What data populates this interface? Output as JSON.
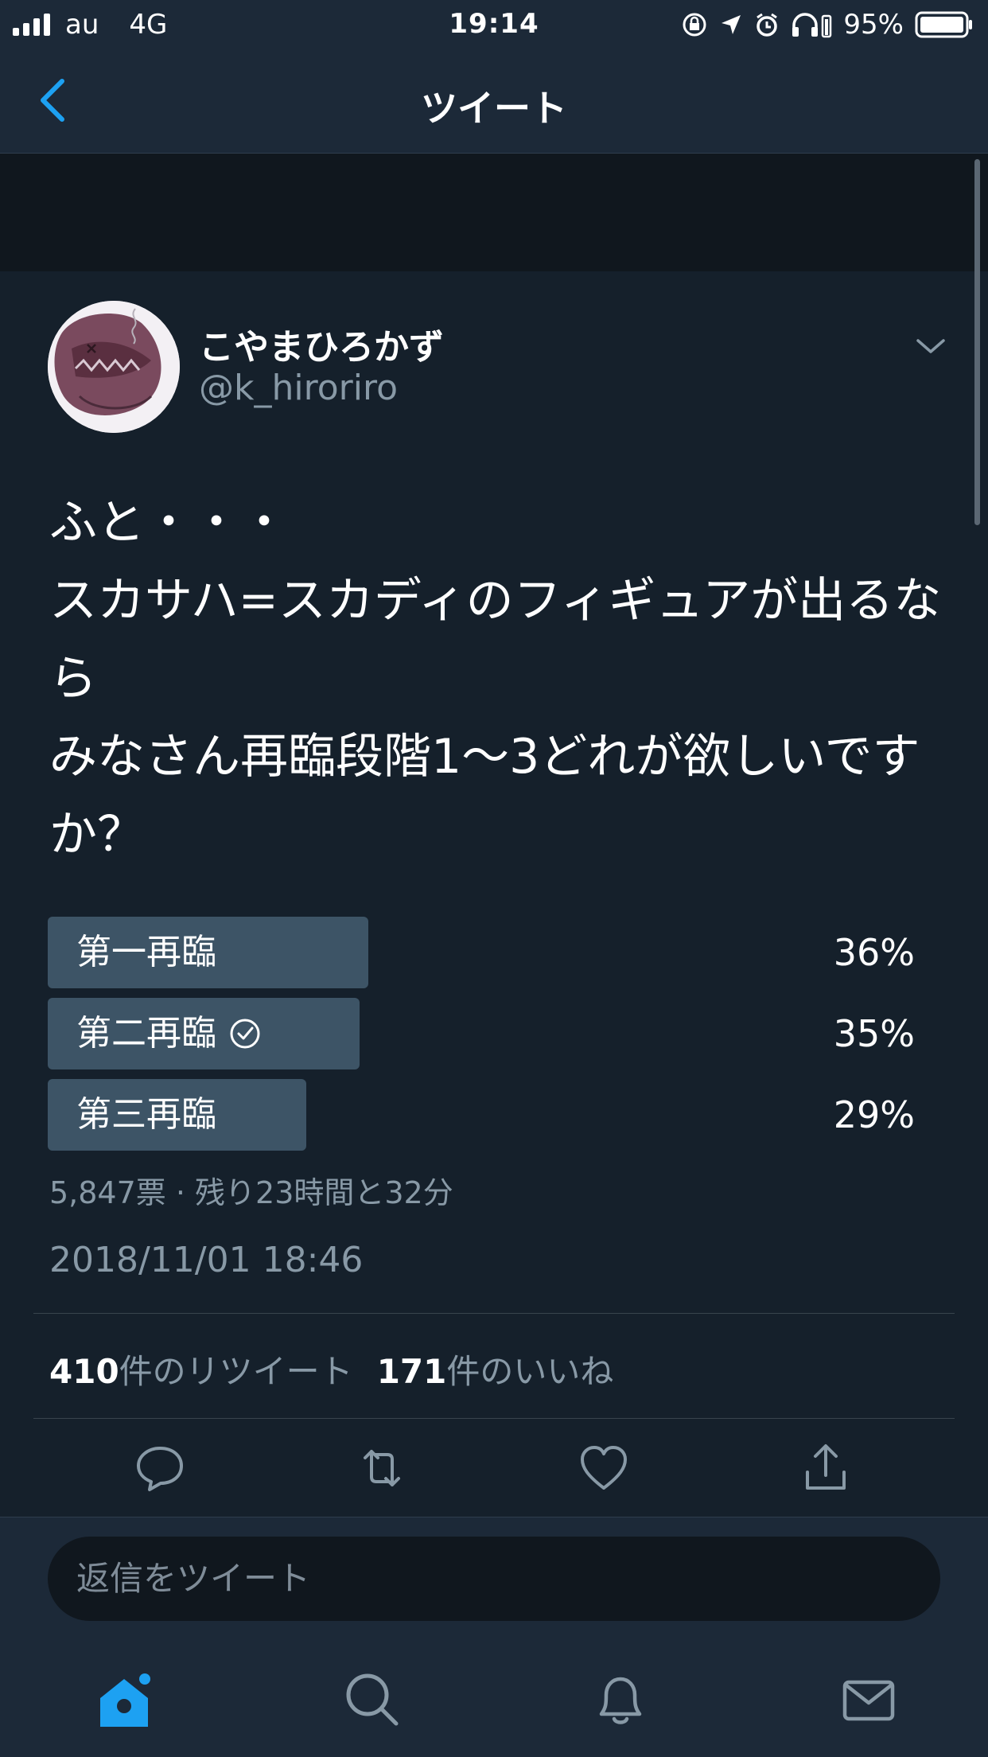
{
  "status_bar": {
    "carrier": "au",
    "network": "4G",
    "time": "19:14",
    "battery": "95%"
  },
  "nav": {
    "title": "ツイート"
  },
  "tweet": {
    "display_name": "こやまひろかず",
    "handle": "@k_hiroriro",
    "text": "ふと・・・\nスカサハ=スカディのフィギュアが出るなら\nみなさん再臨段階1〜3どれが欲しいですか？",
    "timestamp": "2018/11/01 18:46"
  },
  "poll": {
    "options": [
      {
        "label": "第一再臨",
        "percent_text": "36%",
        "percent": 36,
        "selected": false
      },
      {
        "label": "第二再臨",
        "percent_text": "35%",
        "percent": 35,
        "selected": true
      },
      {
        "label": "第三再臨",
        "percent_text": "29%",
        "percent": 29,
        "selected": false
      }
    ],
    "meta": "5,847票 · 残り23時間と32分"
  },
  "stats": {
    "retweets_count": "410",
    "retweets_label": "件のリツイート",
    "likes_count": "171",
    "likes_label": "件のいいね"
  },
  "reply": {
    "placeholder": "返信をツイート"
  },
  "colors": {
    "background": "#15202b",
    "accent": "#1da1f2",
    "poll_bar": "#3d5466",
    "secondary_text": "#8899a6"
  },
  "icons": {
    "back": "chevron-left-icon",
    "menu": "chevron-down-icon",
    "reply": "reply-icon",
    "retweet": "retweet-icon",
    "like": "heart-icon",
    "share": "share-icon",
    "home": "home-icon",
    "search": "search-icon",
    "notifications": "bell-icon",
    "messages": "mail-icon"
  }
}
